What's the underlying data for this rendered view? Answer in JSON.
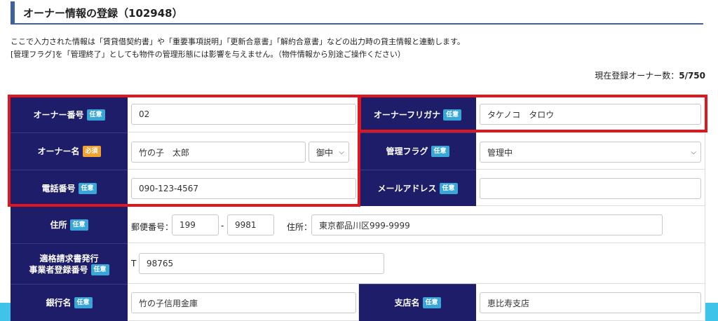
{
  "page": {
    "title": "オーナー情報の登録（102948）",
    "desc1": "ここで入力された情報は「賃貸借契約書」や「重要事項説明」「更新合意書」「解約合意書」などの出力時の貸主情報と連動します。",
    "desc2": "[管理フラグ]を「管理終了」としても物件の管理形態には影響を与えません。（物件情報から別途ご操作ください）",
    "count_label": "現在登録オーナー数：",
    "count_value": "5/750"
  },
  "badges": {
    "optional": "任意",
    "required": "必須"
  },
  "form": {
    "owner_number": {
      "label": "オーナー番号",
      "value": "02"
    },
    "owner_furigana": {
      "label": "オーナーフリガナ",
      "value": "タケノコ　タロウ"
    },
    "owner_name": {
      "label": "オーナー名",
      "value": "竹の子　太郎",
      "honorific": "御中"
    },
    "management_flag": {
      "label": "管理フラグ",
      "value": "管理中"
    },
    "phone": {
      "label": "電話番号",
      "value": "090-123-4567"
    },
    "email": {
      "label": "メールアドレス",
      "value": ""
    },
    "address": {
      "label": "住所",
      "postal_label": "郵便番号：",
      "postal_1": "199",
      "postal_sep": "-",
      "postal_2": "9981",
      "address_label": "住所：",
      "address_value": "東京都品川区999-9999"
    },
    "invoice": {
      "label_line1": "適格請求書発行",
      "label_line2": "事業者登録番号",
      "prefix": "T",
      "value": "98765"
    },
    "bank": {
      "label": "銀行名",
      "value": "竹の子信用金庫"
    },
    "branch": {
      "label": "支店名",
      "value": "恵比寿支店"
    }
  },
  "icons": {
    "select": "chevron-down-icon"
  },
  "colors": {
    "header_bg": "#1d1d69",
    "highlight": "#e0161e",
    "badge_optional": "#39a6d8",
    "badge_required": "#f0a331"
  }
}
